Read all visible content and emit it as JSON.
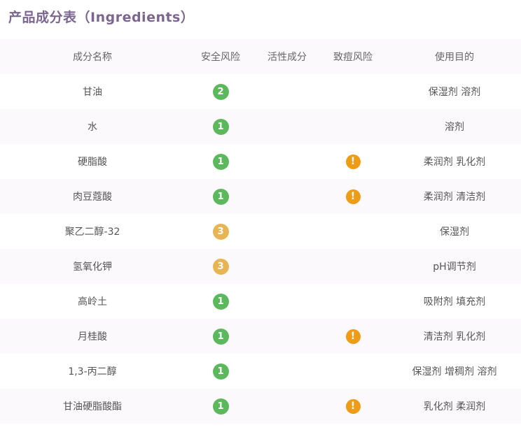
{
  "title": "产品成分表（Ingredients）",
  "colors": {
    "title": "#7c6690",
    "safe_green": "#5cb85c",
    "moderate_yellow": "#e7b553",
    "acne_warning": "#ee9b16"
  },
  "headers": {
    "name": "成分名称",
    "safety": "安全风险",
    "active": "活性成分",
    "acne": "致痘风险",
    "purpose": "使用目的"
  },
  "rows": [
    {
      "name": "甘油",
      "safety": "2",
      "safety_color": "green",
      "acne_icon": "",
      "purpose": "保湿剂 溶剂"
    },
    {
      "name": "水",
      "safety": "1",
      "safety_color": "green",
      "acne_icon": "",
      "purpose": "溶剂"
    },
    {
      "name": "硬脂酸",
      "safety": "1",
      "safety_color": "green",
      "acne_icon": "!",
      "purpose": "柔润剂 乳化剂"
    },
    {
      "name": "肉豆蔻酸",
      "safety": "1",
      "safety_color": "green",
      "acne_icon": "!",
      "purpose": "柔润剂 清洁剂"
    },
    {
      "name": "聚乙二醇-32",
      "safety": "3",
      "safety_color": "yellow",
      "acne_icon": "",
      "purpose": "保湿剂"
    },
    {
      "name": "氢氧化钾",
      "safety": "3",
      "safety_color": "yellow",
      "acne_icon": "",
      "purpose": "pH调节剂"
    },
    {
      "name": "高岭土",
      "safety": "1",
      "safety_color": "green",
      "acne_icon": "",
      "purpose": "吸附剂 填充剂"
    },
    {
      "name": "月桂酸",
      "safety": "1",
      "safety_color": "green",
      "acne_icon": "!",
      "purpose": "清洁剂 乳化剂"
    },
    {
      "name": "1,3-丙二醇",
      "safety": "1",
      "safety_color": "green",
      "acne_icon": "",
      "purpose": "保湿剂 增稠剂 溶剂"
    },
    {
      "name": "甘油硬脂酸酯",
      "safety": "1",
      "safety_color": "green",
      "acne_icon": "!",
      "purpose": "乳化剂 柔润剂"
    }
  ]
}
